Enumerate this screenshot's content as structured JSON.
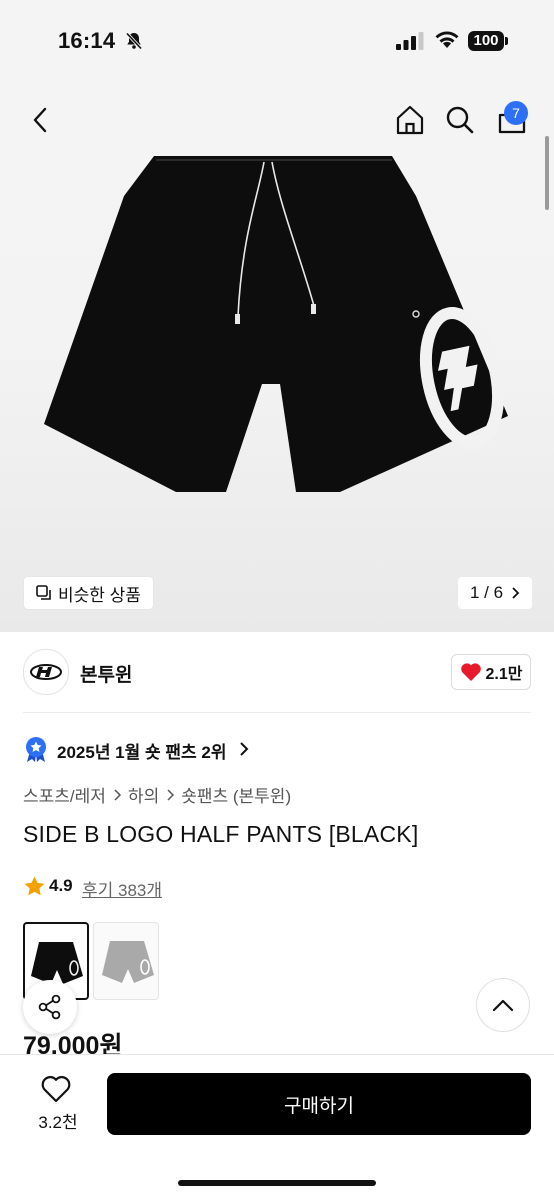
{
  "status_bar": {
    "time": "16:14",
    "battery": "100"
  },
  "nav": {
    "cart_count": "7"
  },
  "gallery": {
    "similar_label": "비슷한 상품",
    "counter": "1 / 6"
  },
  "brand": {
    "name": "본투윈",
    "likes": "2.1만"
  },
  "ranking": {
    "text": "2025년 1월 숏 팬츠 2위"
  },
  "breadcrumb": {
    "items": [
      "스포츠/레저",
      "하의",
      "숏팬츠 (본투윈)"
    ]
  },
  "product": {
    "title": "SIDE B LOGO HALF PANTS [BLACK]",
    "rating": "4.9",
    "reviews": "후기 383개",
    "price": "79,000원"
  },
  "bottom_bar": {
    "fav_count": "3.2천",
    "buy_label": "구매하기"
  },
  "colors": {
    "accent_blue": "#2d6ff7",
    "heart_red": "#e8192c",
    "star_orange": "#f2a100"
  }
}
